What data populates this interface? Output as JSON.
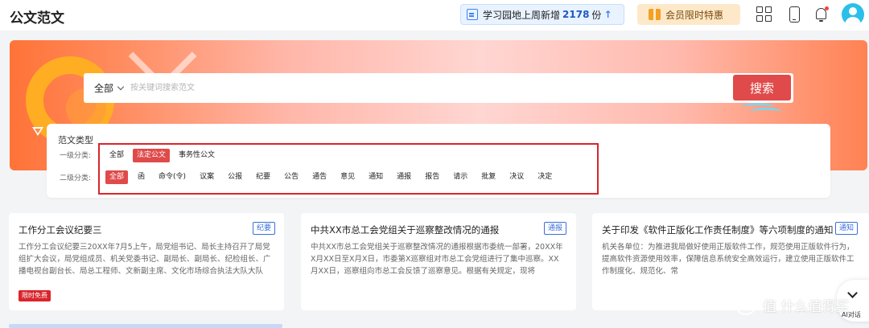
{
  "header": {
    "brand": "公文范文",
    "notice": {
      "prefix": "学习园地上周新增",
      "count": "2178",
      "suffix": "份"
    },
    "vip_label": "会员限时特惠",
    "icons": [
      "grid-icon",
      "phone-icon",
      "bell-icon",
      "avatar"
    ]
  },
  "search": {
    "scope": "全部",
    "placeholder": "按关键词搜索范文",
    "button": "搜索"
  },
  "filter": {
    "title": "范文类型",
    "level1_label": "一级分类:",
    "level2_label": "二级分类:",
    "level1": [
      {
        "label": "全部",
        "active": false
      },
      {
        "label": "法定公文",
        "active": true
      },
      {
        "label": "事务性公文",
        "active": false
      }
    ],
    "level2": [
      {
        "label": "全部",
        "active": true
      },
      {
        "label": "函",
        "active": false
      },
      {
        "label": "命令(令)",
        "active": false
      },
      {
        "label": "议案",
        "active": false
      },
      {
        "label": "公报",
        "active": false
      },
      {
        "label": "纪要",
        "active": false
      },
      {
        "label": "公告",
        "active": false
      },
      {
        "label": "通告",
        "active": false
      },
      {
        "label": "意见",
        "active": false
      },
      {
        "label": "通知",
        "active": false
      },
      {
        "label": "通报",
        "active": false
      },
      {
        "label": "报告",
        "active": false
      },
      {
        "label": "请示",
        "active": false
      },
      {
        "label": "批复",
        "active": false
      },
      {
        "label": "决议",
        "active": false
      },
      {
        "label": "决定",
        "active": false
      }
    ]
  },
  "cards": [
    {
      "title": "工作分工会议纪要三",
      "tag": "纪要",
      "body": "工作分工会议纪要三20XX年7月5上午，局党组书记、局长主持召开了局党组扩大会议，局党组成员、机关党委书记、副局长、副局长、纪检组长、广播电视台副台长、局总工程师、文新副主席、文化市场综合执法大队大队",
      "badge": "限时免费"
    },
    {
      "title": "中共XX市总工会党组关于巡察整改情况的通报",
      "tag": "通报",
      "body": "中共XX市总工会党组关于巡察整改情况的通报根据市委统一部署，20XX年X月XX日至X月X日，市委第X巡察组对市总工会党组进行了集中巡察。XX月XX日，巡察组向市总工会反馈了巡察意见。根据有关规定，现将"
    },
    {
      "title": "关于印发《软件正版化工作责任制度》等六项制度的通知",
      "tag": "通知",
      "body": "机关各单位：为推进我局做好使用正版软件工作，规范使用正版软件行为，提高软件资源使用效率，保障信息系统安全高效运行，建立使用正版软件工作制度化、规范化、常"
    }
  ],
  "float": {
    "ai_label": "AI对话"
  },
  "watermark": "值 什么值得买"
}
